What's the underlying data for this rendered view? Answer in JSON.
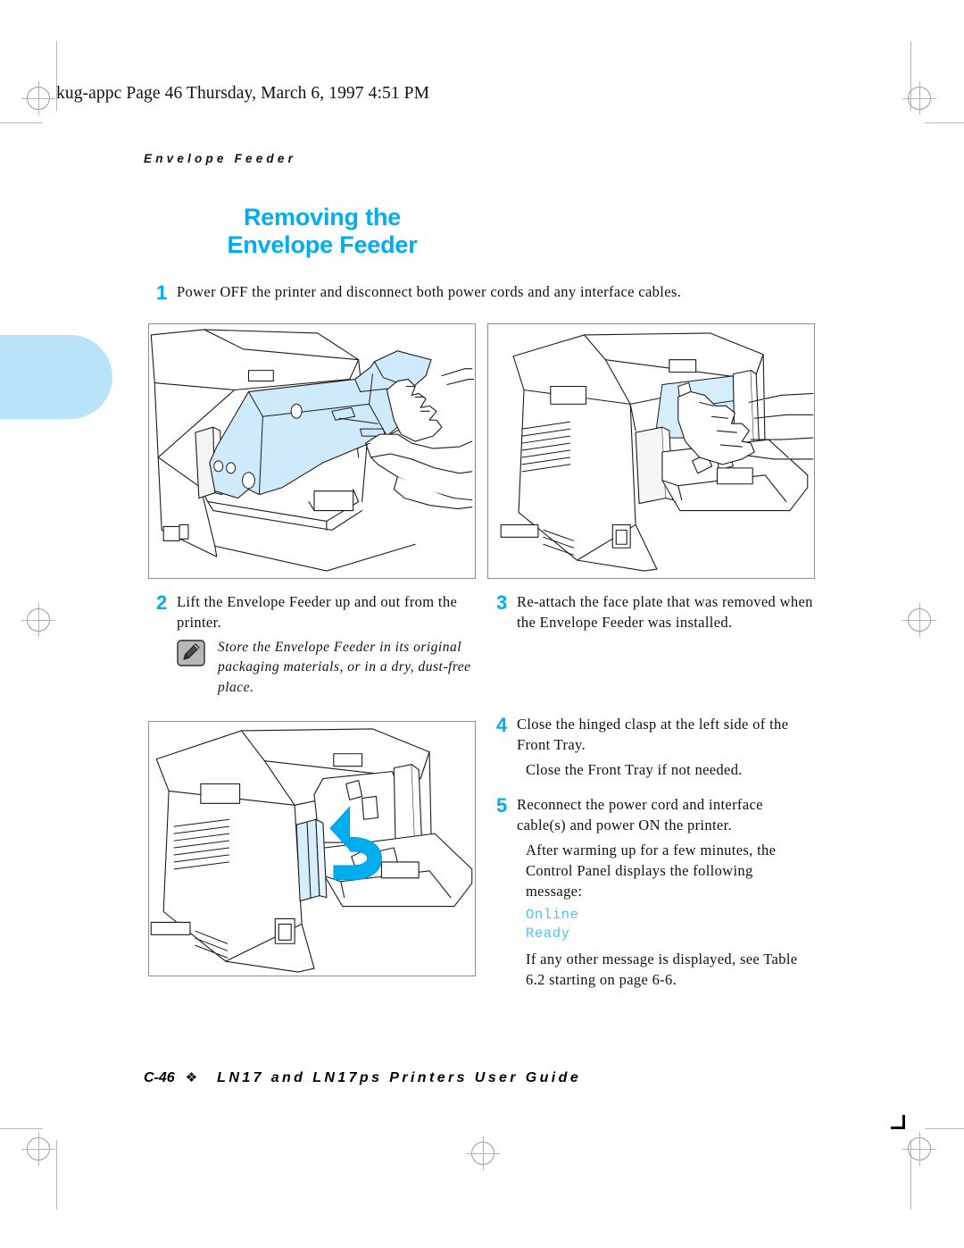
{
  "page": {
    "file_header": "kug-appc  Page 46  Thursday, March 6, 1997  4:51 PM",
    "running_head": "Envelope Feeder",
    "title_line1": "Removing the",
    "title_line2": "Envelope Feeder",
    "accent_color": "#00AEEF",
    "tab_color": "#B9E3F9",
    "console_color": "#4FC3F7"
  },
  "steps": [
    {
      "number": "1",
      "text": "Power OFF the printer and disconnect both power cords and any interface cables."
    },
    {
      "number": "2",
      "text": "Lift the Envelope Feeder up and out from the printer."
    },
    {
      "number": "3",
      "text": "Re-attach the face plate that was removed when the Envelope Feeder was installed."
    },
    {
      "number": "4",
      "text": "Close the hinged clasp at the left side of the Front Tray."
    },
    {
      "number": "5",
      "text": "Reconnect the power cord and interface cable(s) and power ON the printer."
    }
  ],
  "note": {
    "icon": "pencil-icon",
    "text": "Store the Envelope Feeder in its original packaging materials, or in a dry, dust-free place."
  },
  "paragraphs": {
    "after_step4": "Close the Front Tray if not needed.",
    "after_step5": "After warming up for a few minutes, the Control Panel displays the following message:",
    "after_console": "If any other message is displayed, see Table 6.2 starting on page 6-6."
  },
  "console_message": {
    "line1": "Online",
    "line2": "Ready"
  },
  "figures": [
    {
      "name": "figure-remove-envelope-feeder",
      "caption_step": "2",
      "description": "Hands lifting the light-blue Envelope Feeder up and out of the printer front"
    },
    {
      "name": "figure-reattach-face-plate",
      "caption_step": "3",
      "description": "Hand re-attaching the face plate into the printer front tray opening"
    },
    {
      "name": "figure-close-hinged-clasp",
      "caption_step": "4",
      "description": "Printer front with a cyan curved arrow showing the hinged clasp closing"
    }
  ],
  "footer": {
    "page_number": "C-46",
    "ornament": "❖",
    "guide_title": "LN17 and LN17ps Printers User Guide"
  }
}
